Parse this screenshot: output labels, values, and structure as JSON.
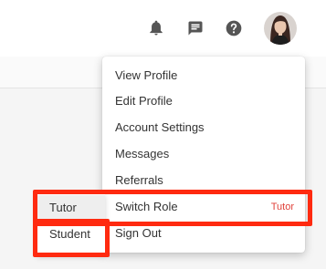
{
  "header": {
    "icons": [
      "bell-icon",
      "chat-icon",
      "help-icon",
      "avatar"
    ]
  },
  "menu": {
    "items": [
      {
        "label": "View Profile"
      },
      {
        "label": "Edit Profile"
      },
      {
        "label": "Account Settings"
      },
      {
        "label": "Messages"
      },
      {
        "label": "Referrals"
      },
      {
        "label": "Switch Role",
        "current_role": "Tutor"
      },
      {
        "label": "Sign Out"
      }
    ]
  },
  "role_submenu": {
    "items": [
      {
        "label": "Tutor",
        "selected": true
      },
      {
        "label": "Student",
        "selected": false
      }
    ]
  },
  "colors": {
    "highlight": "#ff2a10",
    "current_role_text": "#e0423a",
    "icon": "#555555"
  }
}
